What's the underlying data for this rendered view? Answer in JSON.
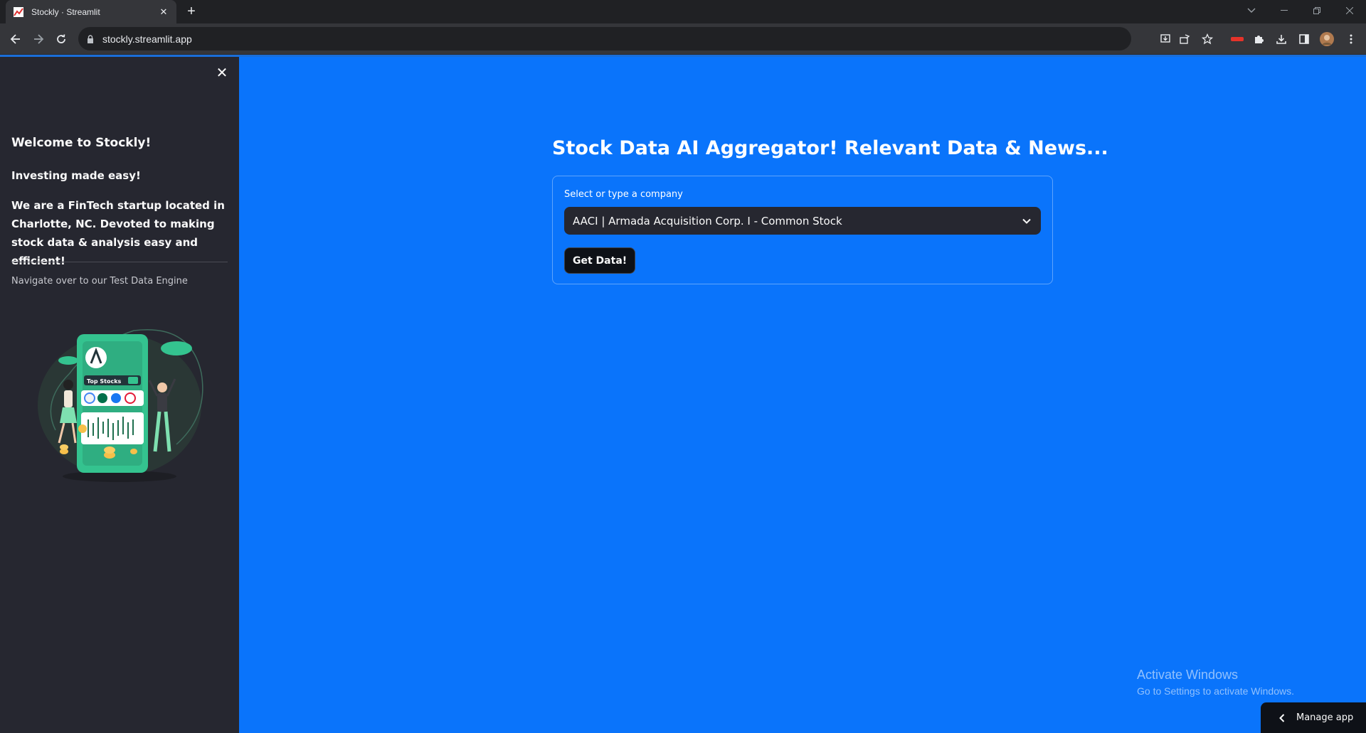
{
  "browser": {
    "tab_title": "Stockly · Streamlit",
    "url": "stockly.streamlit.app"
  },
  "sidebar": {
    "welcome": "Welcome to Stockly!",
    "tagline": "Investing made easy!",
    "about": "We are a FinTech startup located in Charlotte, NC. Devoted to making stock data & analysis easy and efficient!",
    "nav_text": "Navigate over to our Test Data Engine",
    "illustration_label": "Top Stocks"
  },
  "main": {
    "title": "Stock Data AI Aggregator! Relevant Data & News...",
    "select_label": "Select or type a company",
    "select_value": "AACI | Armada Acquisition Corp. I - Common Stock",
    "button_label": "Get Data!"
  },
  "watermark": {
    "title": "Activate Windows",
    "subtitle": "Go to Settings to activate Windows."
  },
  "manage_app_label": "Manage app",
  "colors": {
    "main_bg": "#0a74fb",
    "sidebar_bg": "#262730",
    "button_bg": "#0e1117"
  }
}
